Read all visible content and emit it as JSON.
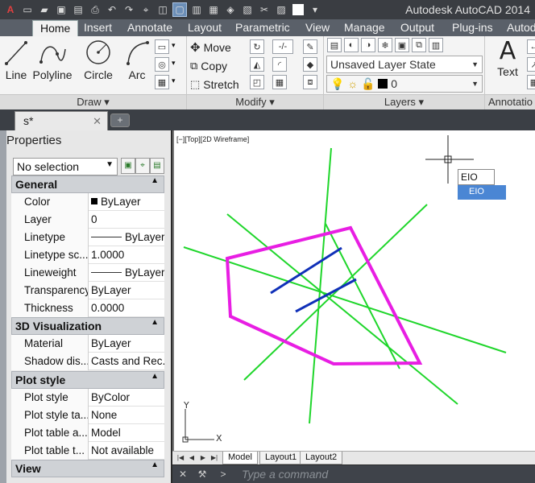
{
  "app": {
    "title": "Autodesk AutoCAD 2014"
  },
  "quick_access": {
    "icons": [
      "app-menu-icon",
      "new-icon",
      "open-icon",
      "save-icon",
      "save-as-icon",
      "print-icon",
      "undo-icon",
      "redo-icon",
      "match-icon",
      "layer-icon",
      "viewport-icon",
      "layout-icon",
      "publish-icon",
      "render-icon",
      "sheet-icon",
      "cut-icon",
      "paste-icon",
      "color-icon",
      "dropdown-icon"
    ]
  },
  "ribbon_tabs": [
    "Home",
    "Insert",
    "Annotate",
    "Layout",
    "Parametric",
    "View",
    "Manage",
    "Output",
    "Plug-ins",
    "Autod"
  ],
  "active_tab": "Home",
  "draw_panel": {
    "tools": [
      "Line",
      "Polyline",
      "Circle",
      "Arc"
    ],
    "footer": "Draw"
  },
  "modify_panel": {
    "tools": [
      "Move",
      "Copy",
      "Stretch"
    ],
    "footer": "Modify"
  },
  "layers_panel": {
    "layer_state": "Unsaved Layer State",
    "current_layer": "0",
    "footer": "Layers"
  },
  "annotation_panel": {
    "text_label": "Text",
    "footer": "Annotatio"
  },
  "drawing_tab": {
    "name": "s*",
    "close": "✕"
  },
  "properties": {
    "title": "Properties",
    "selection": "No selection",
    "sections": [
      {
        "title": "General",
        "rows": [
          {
            "key": "Color",
            "value": "ByLayer"
          },
          {
            "key": "Layer",
            "value": "0"
          },
          {
            "key": "Linetype",
            "value": "ByLayer"
          },
          {
            "key": "Linetype sc...",
            "value": "1.0000"
          },
          {
            "key": "Lineweight",
            "value": "ByLayer"
          },
          {
            "key": "Transparency",
            "value": "ByLayer"
          },
          {
            "key": "Thickness",
            "value": "0.0000"
          }
        ]
      },
      {
        "title": "3D Visualization",
        "rows": [
          {
            "key": "Material",
            "value": "ByLayer"
          },
          {
            "key": "Shadow dis...",
            "value": "Casts and Rec..."
          }
        ]
      },
      {
        "title": "Plot style",
        "rows": [
          {
            "key": "Plot style",
            "value": "ByColor"
          },
          {
            "key": "Plot style ta...",
            "value": "None"
          },
          {
            "key": "Plot table a...",
            "value": "Model"
          },
          {
            "key": "Plot table t...",
            "value": "Not available"
          }
        ]
      },
      {
        "title": "View",
        "rows": []
      }
    ]
  },
  "viewport": {
    "label": "[−][Top][2D Wireframe]",
    "command_input": "EIO",
    "suggestion": "EIO",
    "colors": {
      "lines": "#1fd62b",
      "polygon": "#e81ee3",
      "short_lines": "#1030b8"
    }
  },
  "layout_tabs": [
    "Model",
    "Layout1",
    "Layout2"
  ],
  "command_line": {
    "prompt": "Type a command"
  }
}
